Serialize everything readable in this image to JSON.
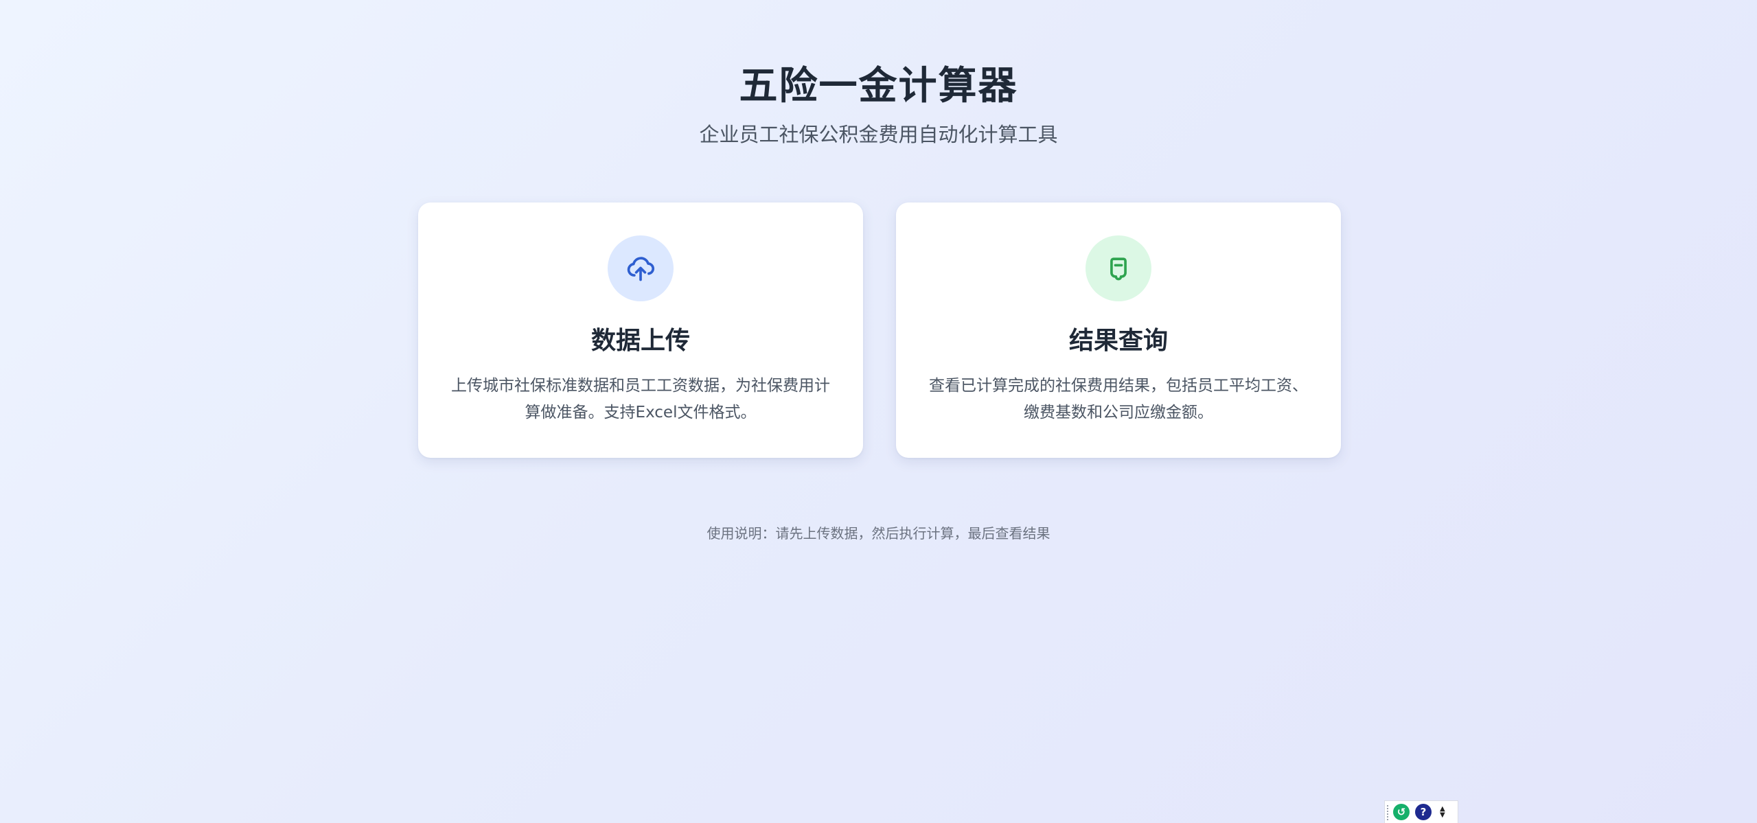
{
  "header": {
    "title": "五险一金计算器",
    "subtitle": "企业员工社保公积金费用自动化计算工具"
  },
  "cards": [
    {
      "icon": "cloud-upload-icon",
      "title": "数据上传",
      "description": "上传城市社保标准数据和员工工资数据，为社保费用计算做准备。支持Excel文件格式。"
    },
    {
      "icon": "clipboard-icon",
      "title": "结果查询",
      "description": "查看已计算完成的社保费用结果，包括员工平均工资、缴费基数和公司应缴金额。"
    }
  ],
  "footer": {
    "note": "使用说明：请先上传数据，然后执行计算，最后查看结果"
  },
  "widget": {
    "buttons": [
      "link-icon",
      "help-icon",
      "up-down-arrows-icon"
    ]
  },
  "colors": {
    "upload_accent": "#2f5fd0",
    "upload_bg": "#dce8ff",
    "result_accent": "#2ea44f",
    "result_bg": "#dcf8e5"
  }
}
